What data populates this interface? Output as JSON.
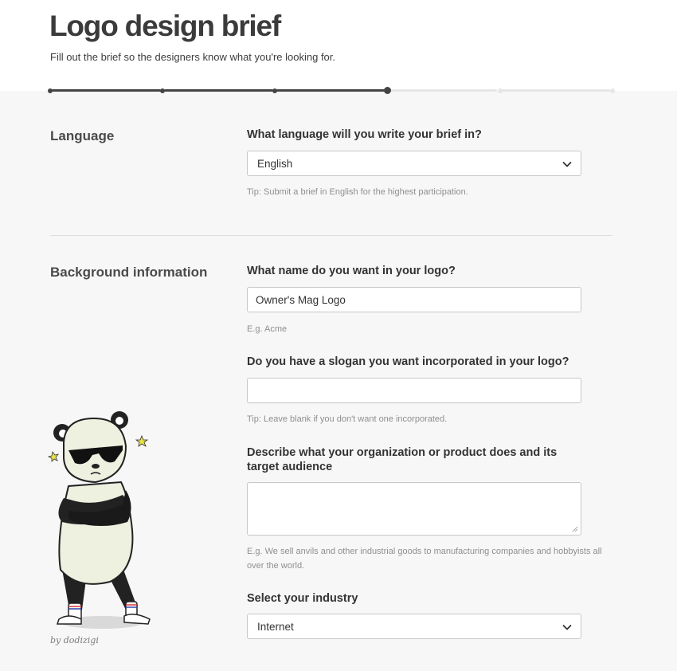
{
  "header": {
    "title": "Logo design brief",
    "subtitle": "Fill out the brief so the designers know what you're looking for."
  },
  "progress": {
    "total_steps": 6,
    "current_step": 4
  },
  "language_section": {
    "title": "Language",
    "question": "What language will you write your brief in?",
    "selected": "English",
    "tip": "Tip: Submit a brief in English for the highest participation."
  },
  "background_section": {
    "title": "Background information",
    "name_question": "What name do you want in your logo?",
    "name_value": "Owner's Mag Logo",
    "name_hint": "E.g. Acme",
    "slogan_question": "Do you have a slogan you want incorporated in your logo?",
    "slogan_value": "",
    "slogan_tip": "Tip: Leave blank if you don't want one incorporated.",
    "describe_question": "Describe what your organization or product does and its target audience",
    "describe_value": "",
    "describe_hint": "E.g. We sell anvils and other industrial goods to manufacturing companies and hobbyists all over the world.",
    "industry_question": "Select your industry",
    "industry_selected": "Internet"
  },
  "illustration": {
    "credit": "by dodizigi"
  },
  "colors": {
    "primary_text": "#3b3b3b",
    "hint": "#8f8f8f",
    "progress": "#444444",
    "background": "#f7f7f7"
  }
}
